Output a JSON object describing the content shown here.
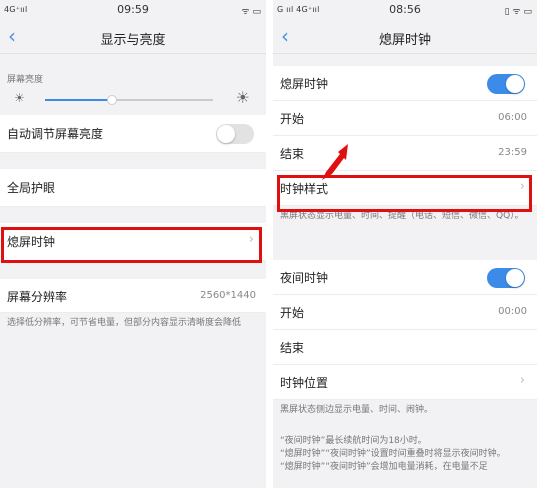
{
  "left": {
    "status": {
      "signal": "4G⁺ııl",
      "time": "09:59",
      "icons": "ᯤ ▭"
    },
    "title": "显示与亮度",
    "brightness": {
      "label": "屏幕亮度",
      "level_percent": 40
    },
    "auto_brightness": {
      "label": "自动调节屏幕亮度",
      "on": false
    },
    "eye_protection": {
      "label": "全局护眼"
    },
    "screen_off_clock": {
      "label": "熄屏时钟"
    },
    "resolution": {
      "label": "屏幕分辨率",
      "value": "2560*1440",
      "desc": "选择低分辨率，可节省电量，但部分内容显示清晰度会降低"
    }
  },
  "right": {
    "status": {
      "signal": "G ııl 4G⁺ııl",
      "time": "08:56",
      "icons": "▯ ᯤ ▭"
    },
    "title": "熄屏时钟",
    "clock_toggle": {
      "label": "熄屏时钟",
      "on": true
    },
    "start": {
      "label": "开始",
      "value": "06:00"
    },
    "end": {
      "label": "结束",
      "value": "23:59"
    },
    "clock_style": {
      "label": "时钟样式"
    },
    "clock_desc": "黑屏状态显示电量、时间、提醒（电话、短信、微信、QQ）。",
    "night_clock": {
      "label": "夜间时钟",
      "on": true
    },
    "night_start": {
      "label": "开始",
      "value": "00:00"
    },
    "night_end": {
      "label": "结束"
    },
    "clock_position": {
      "label": "时钟位置"
    },
    "night_desc": "黑屏状态侧边显示电量、时间、闹钟。",
    "notes": [
      "“夜间时钟”最长续航时间为18小时。",
      "“熄屏时钟”“夜间时钟”设置时间重叠时将显示夜间时钟。",
      "“熄屏时钟”“夜间时钟”会增加电量消耗，在电量不足"
    ]
  },
  "colors": {
    "accent": "#3d8be8",
    "highlight": "#e01010"
  }
}
